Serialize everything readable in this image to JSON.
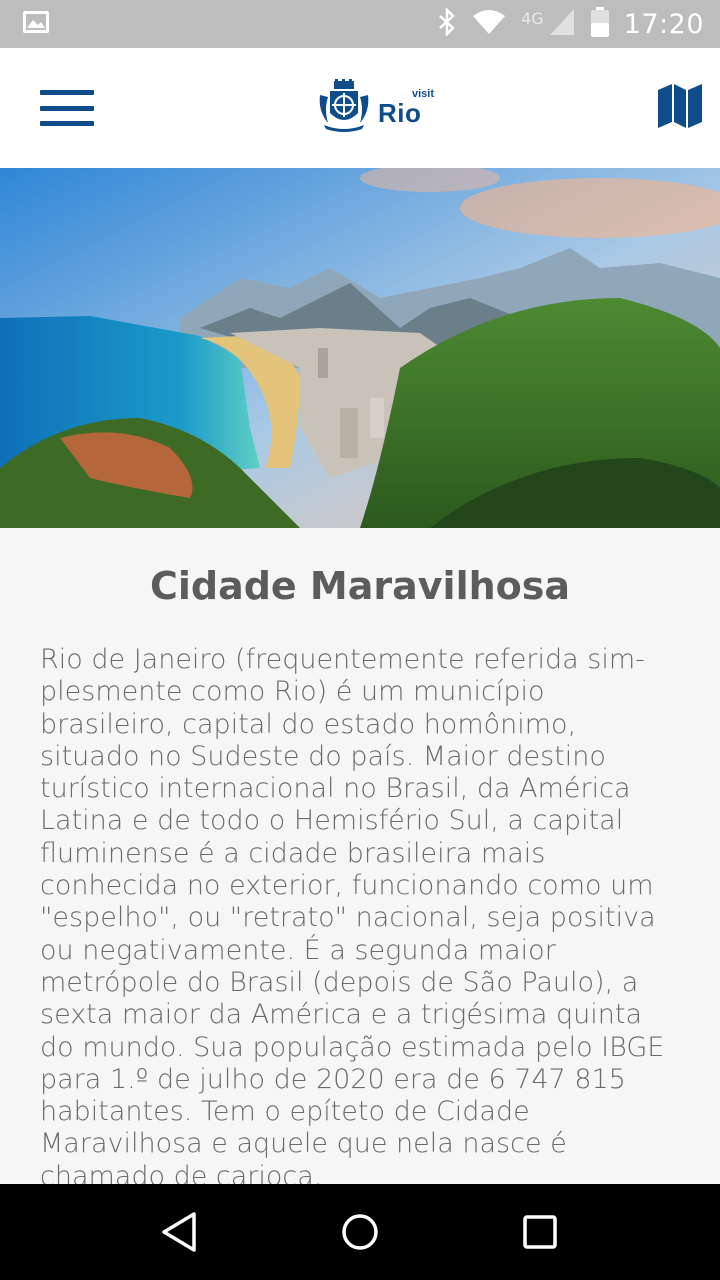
{
  "status_bar": {
    "time": "17:20",
    "network": "4G",
    "icons": [
      "image-icon",
      "bluetooth-icon",
      "wifi-icon",
      "signal-icon",
      "battery-icon"
    ]
  },
  "app_bar": {
    "brand_visit": "visit",
    "brand_name": "Rio",
    "menu_icon": "hamburger-menu-icon",
    "map_icon": "map-icon",
    "accent_color": "#0f4d8a"
  },
  "hero": {
    "image": "rio-de-janeiro-landscape"
  },
  "article": {
    "title": "Cidade Maravilhosa",
    "body": "Rio de Janeiro (frequentemente referida sim­plesmente como Rio) é um município brasileiro, capital do estado homônimo, situado no Sudeste do país. Maior destino turístico internacional no Brasil, da América Latina e de todo o Hemisfério Sul, a capital fluminense é a cidade brasileira mais conhecida no exterior, funcionando como um \"espelho\", ou \"retrato\" nacional, seja positiva ou negativamente. É a segunda maior metrópole do Brasil (depois de São Paulo), a sexta maior da América e a trigésima quinta do mundo. Sua população estimada pelo IBGE para 1.º de julho de 2020 era de 6 747 815 habitantes. Tem o epíteto de Cidade Maravilhosa e aquele que nela nasce é chamado de carioca."
  },
  "nav_bar": {
    "buttons": [
      "back-icon",
      "home-icon",
      "recents-icon"
    ]
  }
}
